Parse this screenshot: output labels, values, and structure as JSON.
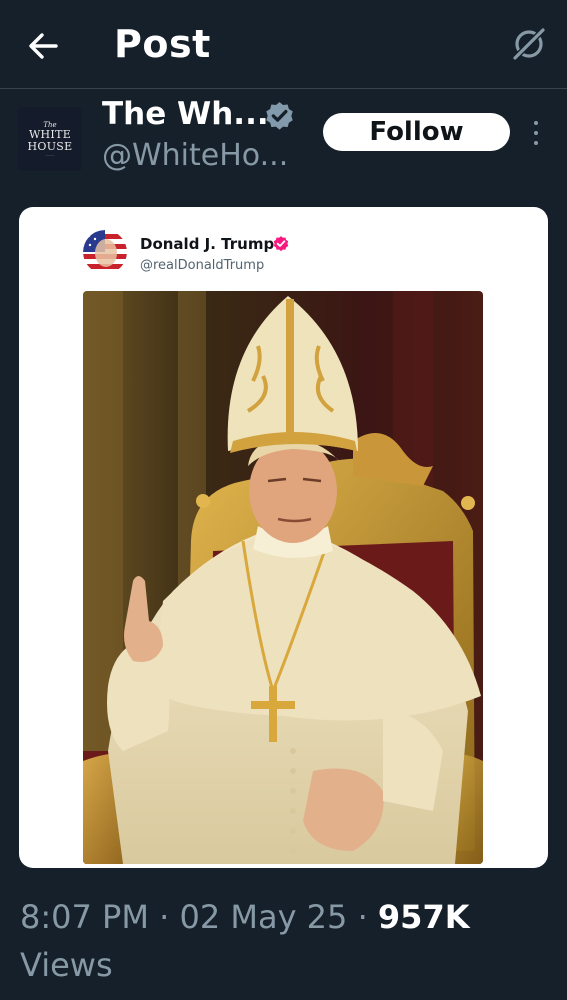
{
  "header": {
    "title": "Post",
    "back_icon": "arrow-left-icon",
    "grok_icon": "grok-icon"
  },
  "author": {
    "name": "The Wh...",
    "handle": "@WhiteHo...",
    "verified_color": "#829aab",
    "follow_label": "Follow",
    "avatar_text": {
      "line1": "The",
      "line2": "WHITE",
      "line3": "HOUSE"
    }
  },
  "embedded_post": {
    "name": "Donald J. Trump",
    "handle": "@realDonaldTrump",
    "verified_color": "#f91880"
  },
  "meta": {
    "time": "8:07 PM",
    "sep1": " · ",
    "date": "02 May 25",
    "sep2": " · ",
    "views_count": "957K",
    "views_label": "Views"
  },
  "colors": {
    "background": "#15202b",
    "secondary_text": "#8899a6",
    "divider": "#38444d"
  }
}
